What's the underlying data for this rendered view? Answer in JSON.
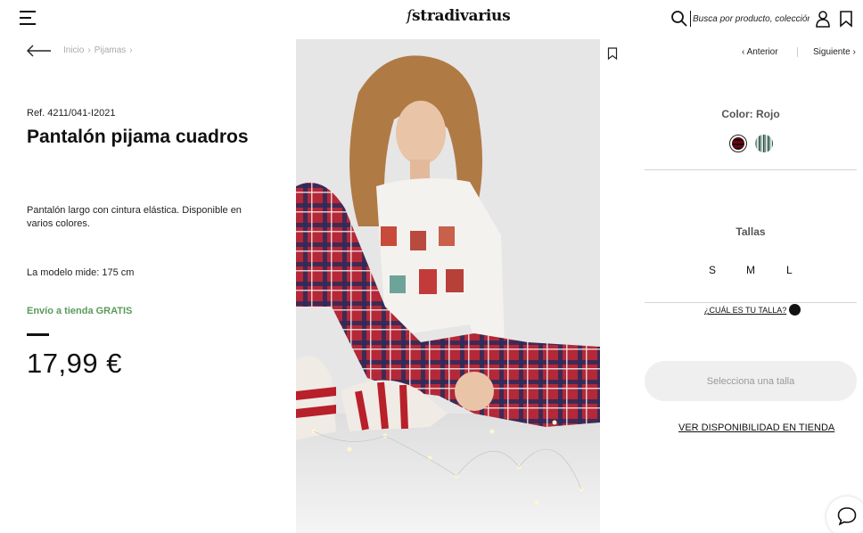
{
  "header": {
    "logo": "stradivarius",
    "search_placeholder": "Busca por producto, colección..."
  },
  "breadcrumb": {
    "items": [
      "Inicio",
      "Pijamas"
    ]
  },
  "product": {
    "ref": "Ref. 4211/041-I2021",
    "title": "Pantalón pijama cuadros",
    "description": "Pantalón largo con cintura elástica. Disponible en varios colores.",
    "model_height": "La modelo mide: 175 cm",
    "shipping": "Envío a tienda GRATIS",
    "price": "17,99 €"
  },
  "navigation": {
    "prev_label": "Anterior",
    "next_label": "Siguiente"
  },
  "options": {
    "color_label": "Color: Rojo",
    "sizes_label": "Tallas",
    "sizes": [
      "S",
      "M",
      "L"
    ],
    "size_guide": "¿CUÁL ES TU TALLA?",
    "select_button": "Selecciona una talla",
    "store_availability": "VER DISPONIBILIDAD EN TIENDA"
  },
  "colors": {
    "accent_green": "#5a9a5a",
    "button_bg": "#efefef",
    "button_text": "#999999"
  },
  "icons": [
    "menu-icon",
    "search-icon",
    "user-icon",
    "wishlist-icon",
    "back-arrow-icon",
    "bookmark-icon",
    "chevron-left-icon",
    "chevron-right-icon",
    "chat-icon",
    "hanger-icon"
  ]
}
